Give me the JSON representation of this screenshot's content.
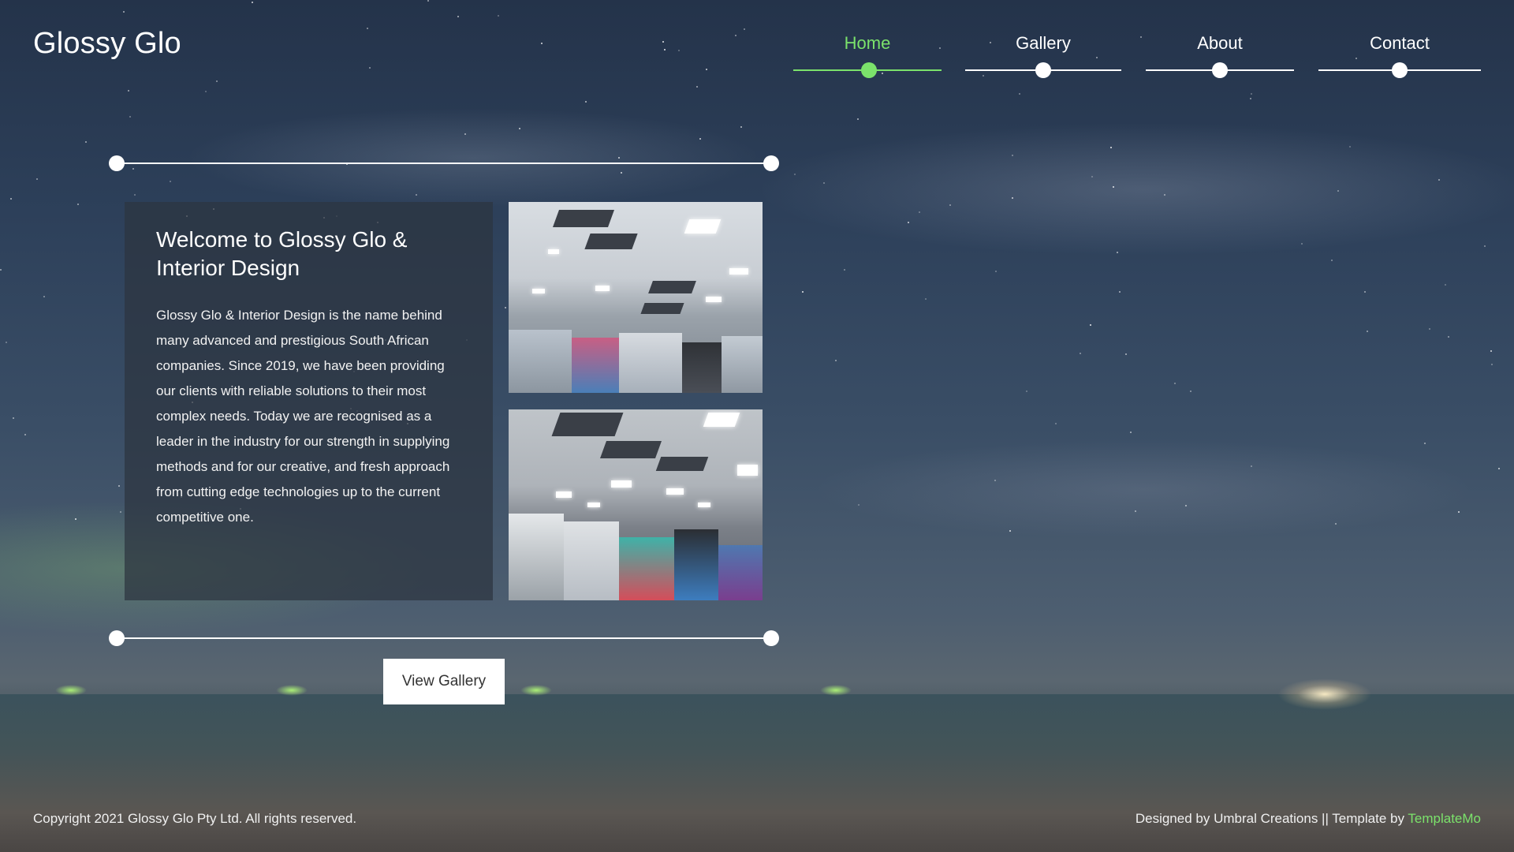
{
  "brand": {
    "name": "Glossy Glo"
  },
  "nav": {
    "items": [
      {
        "label": "Home",
        "active": true
      },
      {
        "label": "Gallery",
        "active": false
      },
      {
        "label": "About",
        "active": false
      },
      {
        "label": "Contact",
        "active": false
      }
    ]
  },
  "intro": {
    "title": "Welcome to Glossy Glo & Interior Design",
    "body": "Glossy Glo & Interior Design is the name behind many advanced and prestigious South African companies. Since 2019, we have been providing our clients with reliable solutions to their most complex needs. Today we are recognised as a leader in the industry for our strength in supplying methods and for our creative, and fresh approach from cutting edge technologies up to the current competitive one."
  },
  "cta": {
    "label": "View Gallery"
  },
  "footer": {
    "copyright": "Copyright 2021 Glossy Glo Pty Ltd. All rights reserved.",
    "credit_prefix": "Designed by Umbral Creations || Template by ",
    "credit_link": "TemplateMo"
  },
  "colors": {
    "accent": "#7be26b",
    "card_bg": "#2d3440",
    "text": "#ffffff"
  }
}
